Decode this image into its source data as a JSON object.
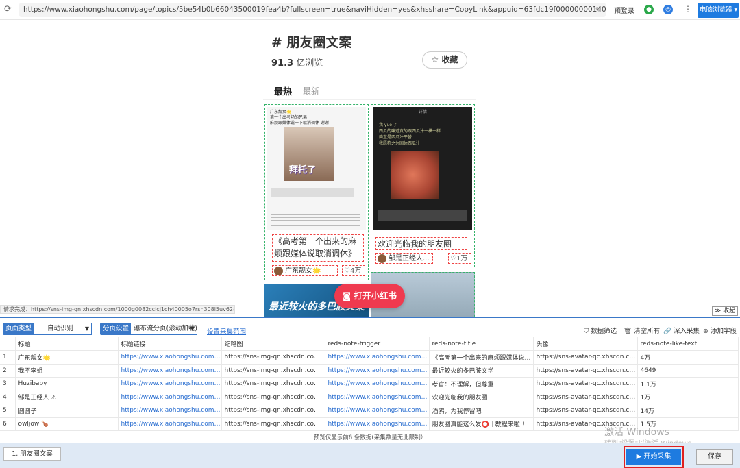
{
  "browser": {
    "url": "https://www.xiaohongshu.com/page/topics/5be54b0b66043500019fea4b?fullscreen=true&naviHidden=yes&xhsshare=CopyLink&appuid=63fdc19f000000001400ca0c&...",
    "login_label": "预登录",
    "mode_label": "电脑浏览器"
  },
  "topic": {
    "title": "# 朋友圈文案",
    "views_num": "91.3",
    "views_label": "亿浏览",
    "collect_label": "收藏",
    "tab_hot": "最热",
    "tab_new": "最新"
  },
  "cards": [
    {
      "title": "《高考第一个出来的麻烦跟媒体说取消调休》",
      "author": "广东靓女🌟",
      "likes": "4万",
      "shot_header": "广东靓女🌟\n第一个出考场的兄弟\n麻烦跟媒体说一下取消调休 谢谢",
      "shot_caption": "拜托了"
    },
    {
      "title": "欢迎光临我的朋友圈",
      "author": "邹是正经人...",
      "likes": "1万",
      "shot_header": "详情",
      "shot_text": "我 yue 了\n西瓜的味道真的跟西瓜汁一模一样\n简直是西瓜汁平替\n我愿称之为固体西瓜汁"
    }
  ],
  "card3_title": "最近较火的多巴胺文案",
  "open_app": "打开小红书",
  "status_text": "请求完成：https://sns-img-qn.xhscdn.com/1000g0082ccicj1ch40005o7rsh308l5uv628...",
  "collapse_label": "收起",
  "panel": {
    "page_type_label": "页面类型",
    "page_type_value": "自动识别",
    "paging_label": "分页设置",
    "paging_value": "瀑布流分页(滚动加载)",
    "range_link": "设置采集范围",
    "tools": [
      "数据筛选",
      "清空所有",
      "深入采集",
      "添加字段"
    ],
    "columns": [
      "标题",
      "标题链接",
      "缩略图",
      "reds-note-trigger",
      "reds-note-title",
      "头像",
      "reds-note-like-text"
    ],
    "rows": [
      [
        "1",
        "广东靓女🌟",
        "https://www.xiaohongshu.com/user/p...",
        "https://sns-img-qn.xhscdn.com/1000...",
        "https://www.xiaohongshu.com/disco...",
        "《高考第一个出来的麻烦跟媒体说取...",
        "https://sns-avatar-qc.xhscdn.com/av...",
        "4万"
      ],
      [
        "2",
        "我不李姐",
        "https://www.xiaohongshu.com/user/p...",
        "https://sns-img-qn.xhscdn.com/1000...",
        "https://www.xiaohongshu.com/disco...",
        "最近较火的多巴胺文学",
        "https://sns-avatar-qc.xhscdn.com/av...",
        "4649"
      ],
      [
        "3",
        "Huzibaby",
        "https://www.xiaohongshu.com/user/p...",
        "https://sns-img-qn.xhscdn.com/1000...",
        "https://www.xiaohongshu.com/disco...",
        "考官：不理解，但尊重",
        "https://sns-avatar-qc.xhscdn.com/av...",
        "1.1万"
      ],
      [
        "4",
        "邹是正经人 ⚠",
        "https://www.xiaohongshu.com/user/p...",
        "https://sns-img-qn.xhscdn.com/1000...",
        "https://www.xiaohongshu.com/disco...",
        "欢迎光临我的朋友圈",
        "https://sns-avatar-qc.xhscdn.com/av...",
        "1万"
      ],
      [
        "5",
        "圆圆子",
        "https://www.xiaohongshu.com/user/p...",
        "https://sns-img-qn.xhscdn.com/1000...",
        "https://www.xiaohongshu.com/disco...",
        "酒鸥，为我停留吧",
        "https://sns-avatar-qc.xhscdn.com/av...",
        "14万"
      ],
      [
        "6",
        "owljowl🍗",
        "https://www.xiaohongshu.com/user/p...",
        "https://sns-img-qn.xhscdn.com/1000...",
        "https://www.xiaohongshu.com/disco...",
        "朋友圈真能这么发⭕｜教程来啦!!",
        "https://sns-avatar-qc.xhscdn.com/av...",
        "1.5万"
      ]
    ],
    "preview_note": "预览仅显示前6 条数据(采集数量无此限制）",
    "watermark": "激活 Windows",
    "watermark_sub": "转到\"设置\"以激活 Windows。",
    "task_tab": "1. 朋友圈文案",
    "start_label": "▶  开始采集",
    "save_label": "保存"
  }
}
